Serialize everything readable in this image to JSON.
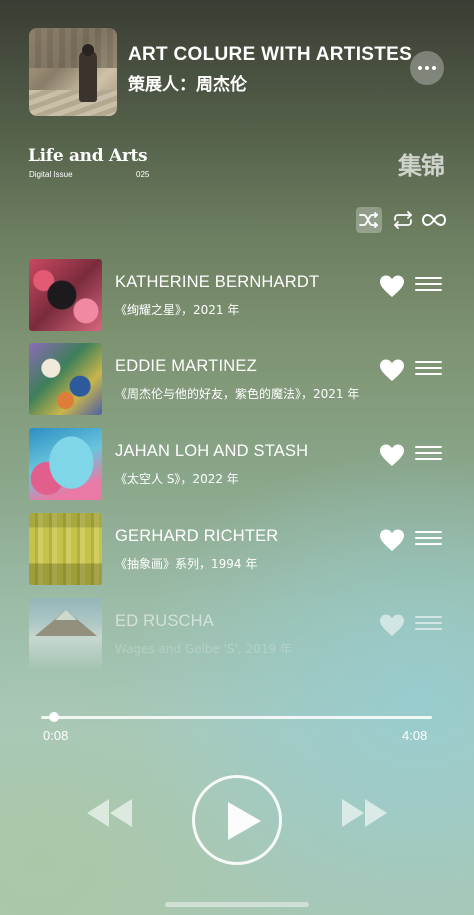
{
  "header": {
    "title": "ART COLURE WITH ARTISTES",
    "curator": "策展人：周杰伦"
  },
  "brand": {
    "title": "Life and Arts",
    "issue": "Digital Issue",
    "number": "025",
    "collection_label": "集锦"
  },
  "controls": {
    "shuffle_icon": "shuffle-icon",
    "repeat_icon": "repeat-icon",
    "infinite_icon": "infinity-icon",
    "shuffle_active": true
  },
  "tracks": [
    {
      "title": "KATHERINE BERNHARDT",
      "subtitle": "《绚耀之星》，2021 年",
      "liked": true
    },
    {
      "title": "EDDIE MARTINEZ",
      "subtitle": "《周杰伦与他的好友，紫色的魔法》，2021 年",
      "liked": true
    },
    {
      "title": "JAHAN LOH AND STASH",
      "subtitle": "《太空人 S》，2022 年",
      "liked": true
    },
    {
      "title": "GERHARD RICHTER",
      "subtitle": "《抽象画》系列，1994 年",
      "liked": true
    },
    {
      "title": "ED RUSCHA",
      "subtitle": "Wages and Gelbe 'S', 2019 年",
      "liked": true
    }
  ],
  "player": {
    "current_time": "0:08",
    "total_time": "4:08",
    "progress_fraction": 0.032
  }
}
